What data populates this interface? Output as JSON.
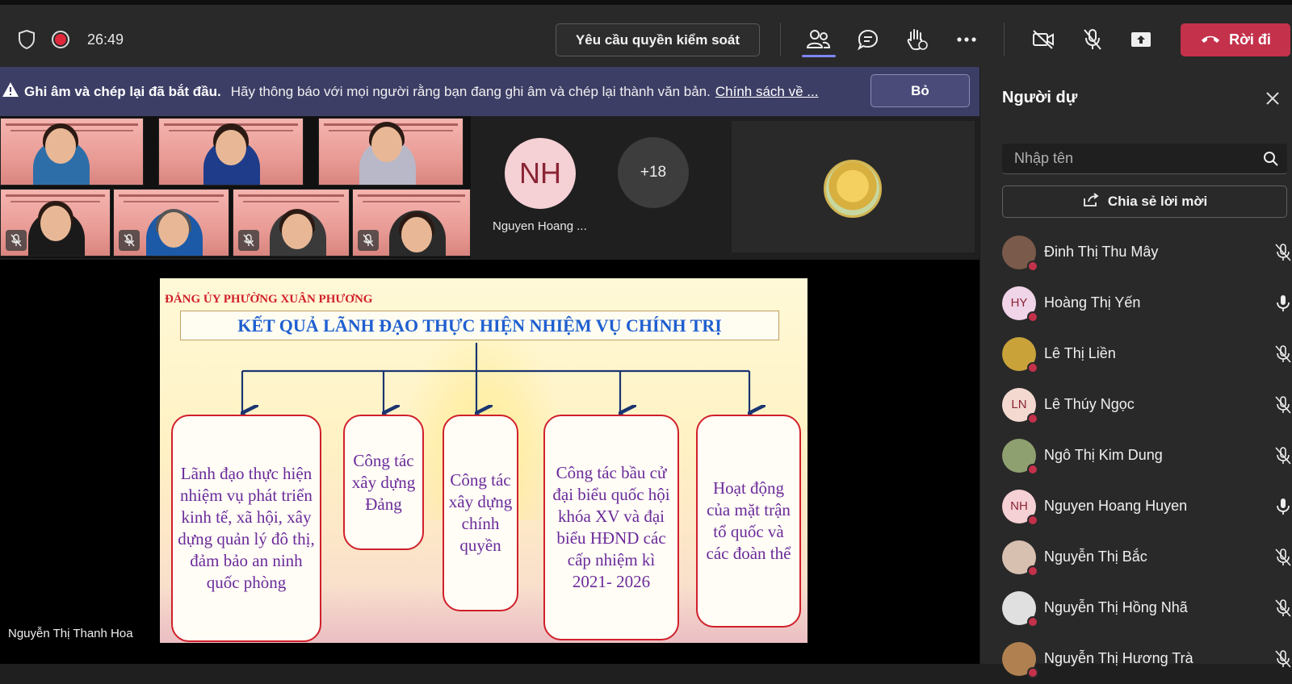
{
  "topbar": {
    "timer": "26:49",
    "request_control": "Yêu cầu quyền kiểm soát",
    "leave": "Rời đi",
    "icons": [
      "shield-icon",
      "record-icon",
      "people-icon",
      "chat-icon",
      "raise-hand-icon",
      "more-icon",
      "camera-off-icon",
      "mic-off-icon",
      "share-icon",
      "hangup-icon"
    ]
  },
  "banner": {
    "bold": "Ghi âm và chép lại đã bắt đầu.",
    "message": "Hãy thông báo với mọi người rằng bạn đang ghi âm và chép lại thành văn bản.",
    "link": "Chính sách về ...",
    "dismiss": "Bỏ"
  },
  "gallery": {
    "nh_initials": "NH",
    "nh_name": "Nguyen Hoang ...",
    "overflow": "+18"
  },
  "slide": {
    "org": "ĐẢNG ỦY PHƯỜNG XUÂN PHƯƠNG",
    "title": "KẾT QUẢ LÃNH ĐẠO THỰC HIỆN NHIỆM VỤ CHÍNH TRỊ",
    "boxes": [
      "Lãnh đạo thực hiện nhiệm vụ phát triển kinh tế, xã hội, xây dựng quản lý đô thị, đảm bảo an ninh quốc phòng",
      "Công tác xây dựng Đảng",
      "Công tác xây dựng chính quyền",
      "Công tác bầu cử đại biểu quốc hội khóa XV và đại biểu HĐND các cấp nhiệm kì 2021- 2026",
      "Hoạt động của mặt trận tổ quốc và các đoàn thể"
    ]
  },
  "presenter": "Nguyễn Thị Thanh Hoa",
  "panel": {
    "title": "Người dự",
    "search_placeholder": "Nhập tên",
    "invite": "Chia sẻ lời mời",
    "participants": [
      {
        "name": "Đinh Thị Thu Mây",
        "initials": "",
        "mic": "off",
        "avatar_color": "#7a5a4a"
      },
      {
        "name": "Hoàng Thị Yến",
        "initials": "HY",
        "mic": "on",
        "avatar_color": "#f0d4e8"
      },
      {
        "name": "Lê Thị Liền",
        "initials": "",
        "mic": "off",
        "avatar_color": "#c9a23a"
      },
      {
        "name": "Lê Thúy Ngọc",
        "initials": "LN",
        "mic": "off",
        "avatar_color": "#f3d9d0"
      },
      {
        "name": "Ngô Thị Kim Dung",
        "initials": "",
        "mic": "off",
        "avatar_color": "#8fa070"
      },
      {
        "name": "Nguyen Hoang Huyen",
        "initials": "NH",
        "mic": "on",
        "avatar_color": "#f5d0d4"
      },
      {
        "name": "Nguyễn Thị Bắc",
        "initials": "",
        "mic": "off",
        "avatar_color": "#d8c0b0"
      },
      {
        "name": "Nguyễn Thị Hồng Nhã",
        "initials": "",
        "mic": "off",
        "avatar_color": "#e0e0e0"
      },
      {
        "name": "Nguyễn Thị Hương Trà",
        "initials": "",
        "mic": "off",
        "avatar_color": "#b08050"
      }
    ]
  }
}
